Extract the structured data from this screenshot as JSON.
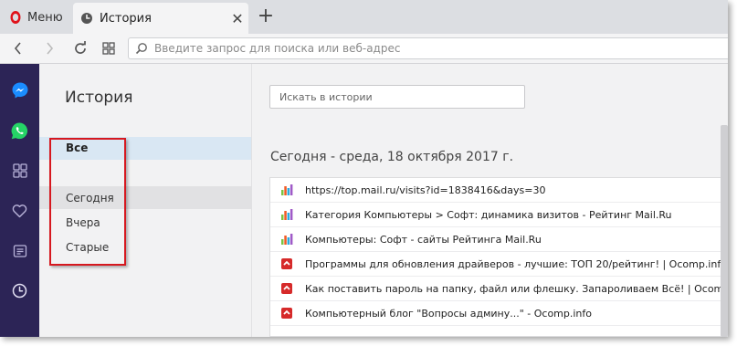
{
  "tabs": {
    "menu_label": "Меню",
    "active_tab_title": "История",
    "close_symbol": "✕",
    "new_tab_symbol": "+"
  },
  "toolbar": {
    "address_placeholder": "Введите запрос для поиска или веб-адрес"
  },
  "sidebar": {
    "items": [
      "messenger-icon",
      "whatsapp-icon",
      "speed-dial-icon",
      "bookmarks-heart-icon",
      "news-icon",
      "history-clock-icon"
    ]
  },
  "history_nav": {
    "title": "История",
    "all": "Все",
    "today": "Сегодня",
    "yesterday": "Вчера",
    "older": "Старые"
  },
  "main": {
    "search_placeholder": "Искать в истории",
    "day_heading": "Сегодня - среда, 18 октября 2017 г.",
    "entries": [
      {
        "icon": "mailru-rating-icon",
        "title": "https://top.mail.ru/visits?id=1838416&days=30"
      },
      {
        "icon": "mailru-rating-icon",
        "title": "Категория Компьютеры > Софт: динамика визитов - Рейтинг Mail.Ru"
      },
      {
        "icon": "mailru-rating-icon",
        "title": "Компьютеры: Софт - сайты Рейтинга Mail.Ru"
      },
      {
        "icon": "ocomp-icon",
        "title": "Программы для обновления драйверов - лучшие: ТОП 20/рейтинг! | Ocomp.info"
      },
      {
        "icon": "ocomp-icon",
        "title": "Как поставить пароль на папку, файл или флешку. Запароливаем Всё! | Ocomp.info"
      },
      {
        "icon": "ocomp-icon",
        "title": "Компьютерный блог \"Вопросы админу...\" - Ocomp.info"
      }
    ]
  },
  "colors": {
    "sidebar_bg": "#2c2456",
    "highlight_box": "#d6181f",
    "selected_nav": "#d9e7f3",
    "opera_red": "#e0131b"
  }
}
